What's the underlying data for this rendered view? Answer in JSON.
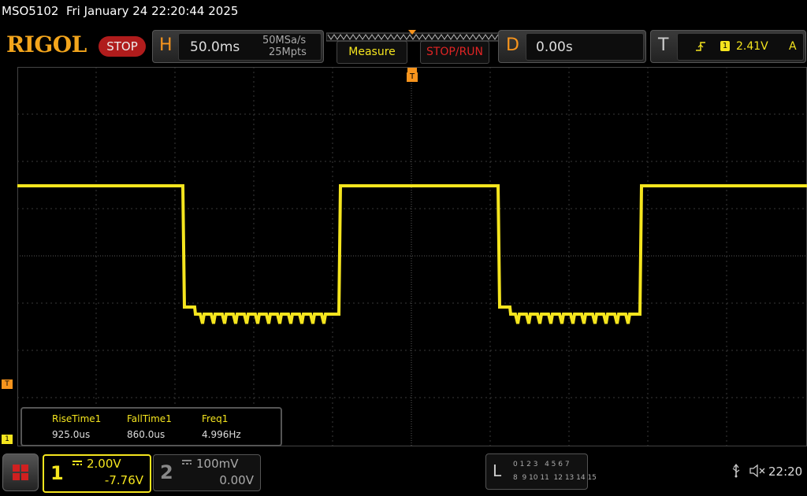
{
  "header": {
    "title": "MSO5102  Fri January 24 22:20:44 2025",
    "logo": "RIGOL",
    "status": "STOP"
  },
  "horizontal": {
    "letter": "H",
    "timebase": "50.0ms",
    "sample_rate": "50MSa/s",
    "memory_depth": "25Mpts"
  },
  "buttons": {
    "measure": "Measure",
    "stop_run": "STOP/RUN"
  },
  "delay": {
    "letter": "D",
    "value": "0.00s"
  },
  "trigger": {
    "letter": "T",
    "source": "1",
    "level": "2.41V",
    "mode": "A",
    "marker_label": "T"
  },
  "channel1": {
    "number": "1",
    "scale": "2.00V",
    "offset": "-7.76V",
    "marker_label": "1",
    "color": "#f5e51e"
  },
  "channel2": {
    "number": "2",
    "scale": "100mV",
    "offset": "0.00V"
  },
  "measurements": [
    {
      "name": "RiseTime1",
      "value": "925.0us"
    },
    {
      "name": "FallTime1",
      "value": "860.0us"
    },
    {
      "name": "Freq1",
      "value": "4.996Hz"
    }
  ],
  "logic": {
    "letter": "L",
    "row1": "0 1 2 3   4 5 6 7",
    "row2": "8  9 10 11  12 13 14 15"
  },
  "status_bar": {
    "time": "22:20"
  },
  "colors": {
    "accent": "#f7941d",
    "trace": "#f5e51e",
    "stop": "#b01c1c"
  }
}
